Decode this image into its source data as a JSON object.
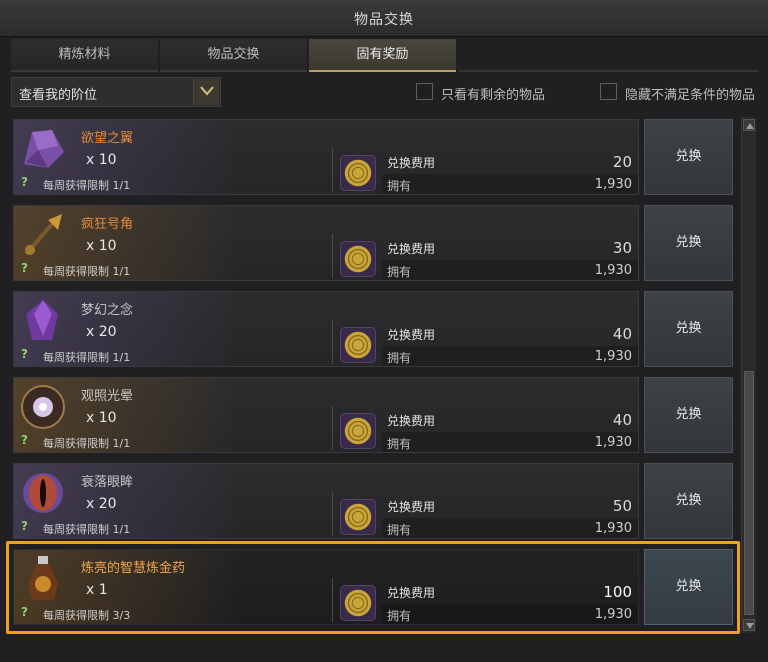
{
  "window": {
    "title": "物品交换"
  },
  "tabs": [
    {
      "label": "精炼材料"
    },
    {
      "label": "物品交换"
    },
    {
      "label": "固有奖励"
    }
  ],
  "filter": {
    "dropdown_value": "查看我的阶位",
    "checkbox_remaining": "只看有剩余的物品",
    "checkbox_hide_unmet": "隐藏不满足条件的物品"
  },
  "common": {
    "cost_label": "兑换费用",
    "own_label": "拥有",
    "exchange_button": "兑换",
    "help_mark": "?"
  },
  "rows": [
    {
      "name": "欲望之翼",
      "qty": "x 10",
      "limit": "每周获得限制 1/1",
      "cost": "20",
      "own": "1,930",
      "icon": "purple-wing-icon"
    },
    {
      "name": "疯狂号角",
      "qty": "x 10",
      "limit": "每周获得限制 1/1",
      "cost": "30",
      "own": "1,930",
      "icon": "horn-icon"
    },
    {
      "name": "梦幻之念",
      "qty": "x 20",
      "limit": "每周获得限制 1/1",
      "cost": "40",
      "own": "1,930",
      "icon": "purple-crystal-icon"
    },
    {
      "name": "观照光晕",
      "qty": "x 10",
      "limit": "每周获得限制 1/1",
      "cost": "40",
      "own": "1,930",
      "icon": "halo-orb-icon"
    },
    {
      "name": "衰落眼眸",
      "qty": "x 20",
      "limit": "每周获得限制 1/1",
      "cost": "50",
      "own": "1,930",
      "icon": "eye-icon"
    },
    {
      "name": "炼亮的智慧炼金药",
      "qty": "x 1",
      "limit": "每周获得限制 3/3",
      "cost": "100",
      "own": "1,930",
      "icon": "potion-icon"
    }
  ],
  "colors": {
    "accent": "#f0a020",
    "item_name_rare": "#e08a3c",
    "help_green": "#8fd06a"
  }
}
